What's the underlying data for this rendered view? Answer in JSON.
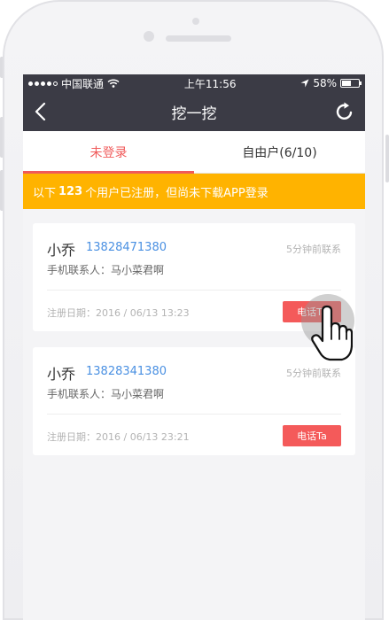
{
  "status_bar": {
    "carrier": "中国联通",
    "time": "上午11:56",
    "battery": "58%",
    "battery_level": 0.58
  },
  "nav": {
    "title": "挖一挖",
    "back_icon": "chevron-left-icon",
    "refresh_icon": "refresh-icon"
  },
  "tabs": [
    {
      "label": "未登录",
      "active": true
    },
    {
      "label": "自由户(6/10)",
      "active": false
    }
  ],
  "banner": {
    "prefix": "以下",
    "count": "123",
    "suffix": "个用户已注册，但尚未下载APP登录"
  },
  "users": [
    {
      "name": "小乔",
      "phone": "13828471380",
      "last_contact": "5分钟前联系",
      "contact": "手机联系人：马小菜君啊",
      "register_date": "注册日期：2016 / 06/13  13:23",
      "call_label": "电话Ta"
    },
    {
      "name": "小乔",
      "phone": "13828341380",
      "last_contact": "5分钟前联系",
      "contact": "手机联系人：马小菜君啊",
      "register_date": "注册日期：2016 / 06/13  23:21",
      "call_label": "电话Ta"
    }
  ],
  "colors": {
    "header_bg": "#3b3b45",
    "accent_red": "#f05a5a",
    "banner_bg": "#ffb300",
    "phone_link": "#4a90e2"
  }
}
